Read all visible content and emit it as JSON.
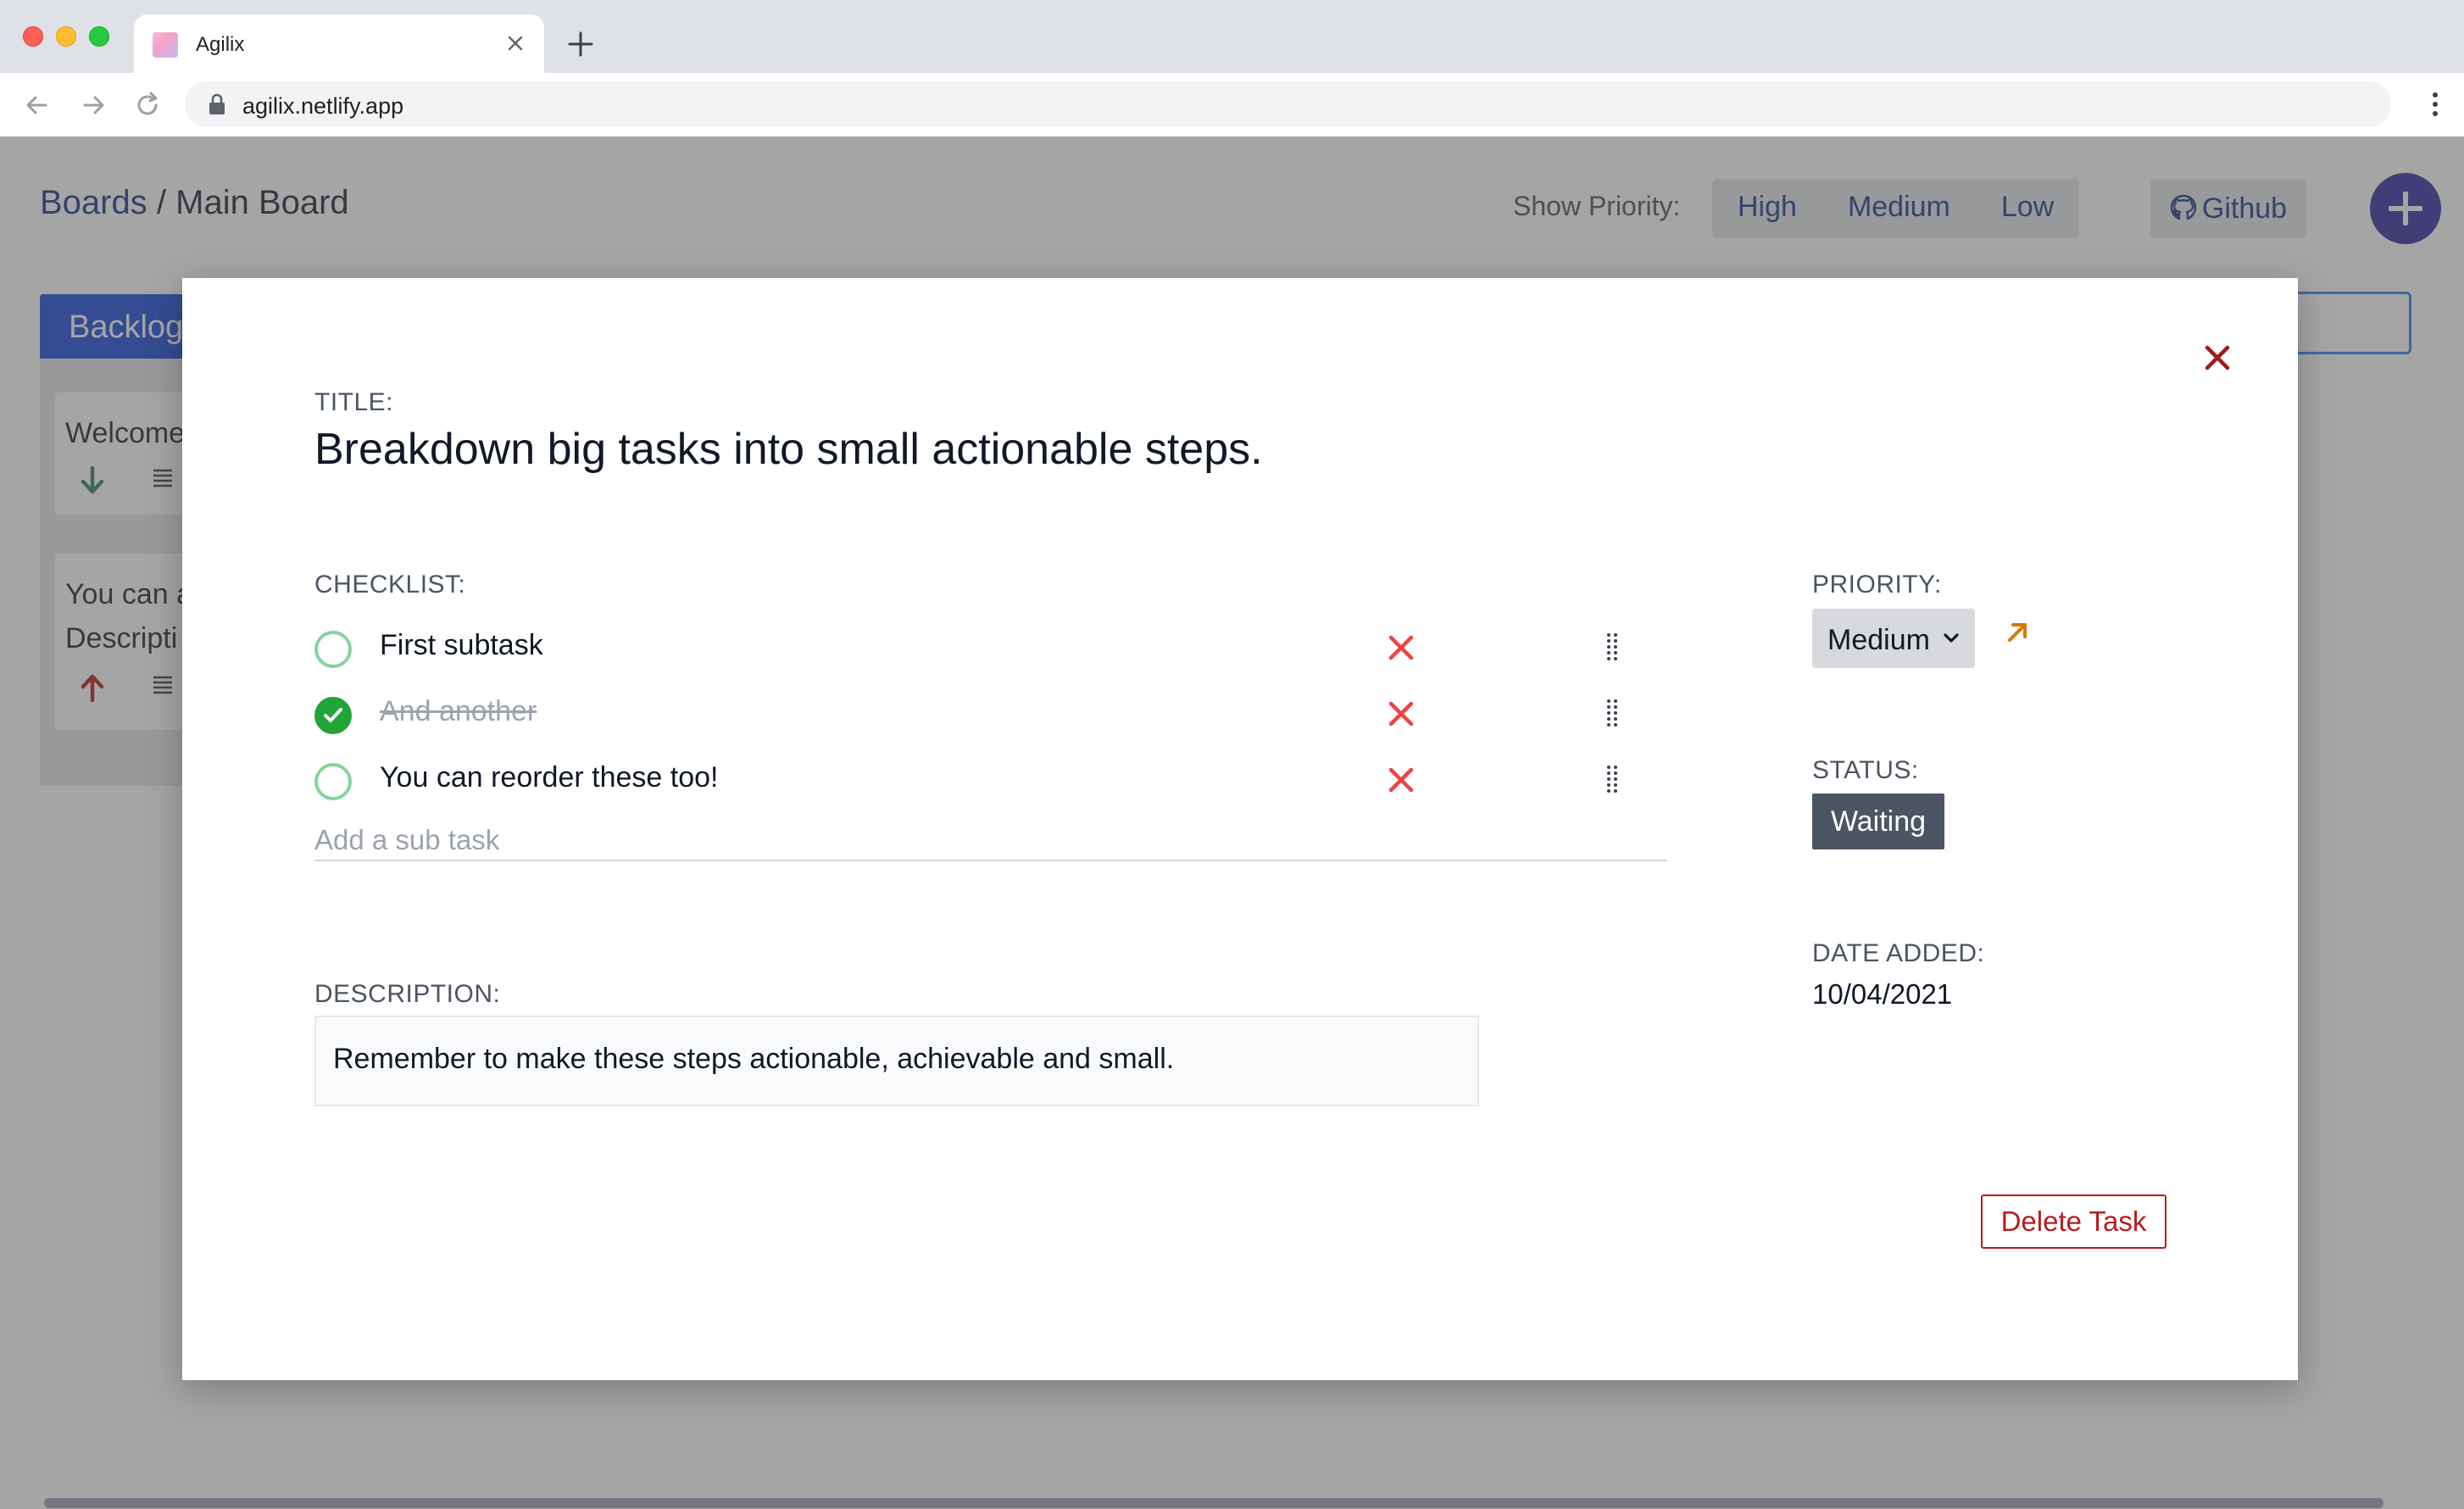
{
  "browser": {
    "tab_title": "Agilix",
    "url": "agilix.netlify.app"
  },
  "header": {
    "breadcrumb_root": "Boards",
    "breadcrumb_sep": "/",
    "breadcrumb_current": "Main Board",
    "show_priority_label": "Show Priority:",
    "priority_filters": [
      "High",
      "Medium",
      "Low"
    ],
    "github_label": "Github"
  },
  "board": {
    "column_title": "Backlog",
    "cards": [
      {
        "text_line1": "Welcome",
        "priority_icon": "arrow-down-icon",
        "priority_color": "#2f855a"
      },
      {
        "text_line1": "You can a",
        "text_line2": "Descripti",
        "priority_icon": "arrow-up-icon",
        "priority_color": "#b91c1c"
      }
    ]
  },
  "modal": {
    "title_label": "TITLE:",
    "title": "Breakdown big tasks into small actionable steps.",
    "checklist_label": "CHECKLIST:",
    "checklist": [
      {
        "text": "First subtask",
        "done": false
      },
      {
        "text": "And another",
        "done": true
      },
      {
        "text": "You can reorder these too!",
        "done": false
      }
    ],
    "subtask_placeholder": "Add a sub task",
    "description_label": "DESCRIPTION:",
    "description": "Remember to make these steps actionable, achievable and small.",
    "priority_label": "PRIORITY:",
    "priority_value": "Medium",
    "status_label": "STATUS:",
    "status_value": "Waiting",
    "date_label": "DATE ADDED:",
    "date_value": "10/04/2021",
    "delete_label": "Delete Task"
  },
  "colors": {
    "brand_blue": "#1e3a8a",
    "accent_indigo": "#3730a3",
    "danger": "#b91c1c",
    "check_green": "#1fa637",
    "priority_arrow": "#d97706"
  }
}
